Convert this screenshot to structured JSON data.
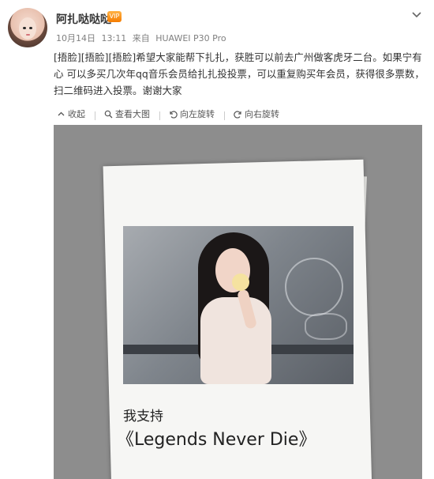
{
  "post": {
    "username": "阿扎哒哒哒",
    "vip_badge": "VIP",
    "date": "10月14日",
    "time": "13:11",
    "source_prefix": "来自",
    "device": "HUAWEI P30 Pro",
    "text": "[捂脸][捂脸][捂脸]希望大家能帮下扎扎，获胜可以前去广州做客虎牙二台。如果宁有心 可以多买几次年qq音乐会员给扎扎投投票，可以重复购买年会员，获得很多票数，扫二维码进入投票。谢谢大家"
  },
  "toolbar": {
    "collect": "收起",
    "view_large": "查看大图",
    "rotate_left": "向左旋转",
    "rotate_right": "向右旋转"
  },
  "image": {
    "caption_line1": "我支持",
    "caption_line2": "《Legends Never Die》"
  },
  "colors": {
    "accent": "#eb7350",
    "meta_gray": "#808080",
    "image_bg": "#8d8d8d"
  },
  "icons": {
    "chevron": "chevron-down-icon",
    "collect": "collapse-icon",
    "view_large": "search-icon",
    "rotate_left": "rotate-left-icon",
    "rotate_right": "rotate-right-icon"
  }
}
